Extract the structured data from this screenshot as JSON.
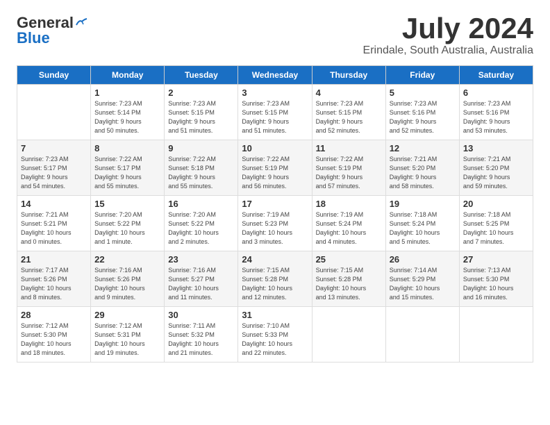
{
  "header": {
    "logo_line1": "General",
    "logo_line2": "Blue",
    "month": "July 2024",
    "location": "Erindale, South Australia, Australia"
  },
  "weekdays": [
    "Sunday",
    "Monday",
    "Tuesday",
    "Wednesday",
    "Thursday",
    "Friday",
    "Saturday"
  ],
  "weeks": [
    [
      {
        "day": "",
        "info": ""
      },
      {
        "day": "1",
        "info": "Sunrise: 7:23 AM\nSunset: 5:14 PM\nDaylight: 9 hours\nand 50 minutes."
      },
      {
        "day": "2",
        "info": "Sunrise: 7:23 AM\nSunset: 5:15 PM\nDaylight: 9 hours\nand 51 minutes."
      },
      {
        "day": "3",
        "info": "Sunrise: 7:23 AM\nSunset: 5:15 PM\nDaylight: 9 hours\nand 51 minutes."
      },
      {
        "day": "4",
        "info": "Sunrise: 7:23 AM\nSunset: 5:15 PM\nDaylight: 9 hours\nand 52 minutes."
      },
      {
        "day": "5",
        "info": "Sunrise: 7:23 AM\nSunset: 5:16 PM\nDaylight: 9 hours\nand 52 minutes."
      },
      {
        "day": "6",
        "info": "Sunrise: 7:23 AM\nSunset: 5:16 PM\nDaylight: 9 hours\nand 53 minutes."
      }
    ],
    [
      {
        "day": "7",
        "info": "Sunrise: 7:23 AM\nSunset: 5:17 PM\nDaylight: 9 hours\nand 54 minutes."
      },
      {
        "day": "8",
        "info": "Sunrise: 7:22 AM\nSunset: 5:17 PM\nDaylight: 9 hours\nand 55 minutes."
      },
      {
        "day": "9",
        "info": "Sunrise: 7:22 AM\nSunset: 5:18 PM\nDaylight: 9 hours\nand 55 minutes."
      },
      {
        "day": "10",
        "info": "Sunrise: 7:22 AM\nSunset: 5:19 PM\nDaylight: 9 hours\nand 56 minutes."
      },
      {
        "day": "11",
        "info": "Sunrise: 7:22 AM\nSunset: 5:19 PM\nDaylight: 9 hours\nand 57 minutes."
      },
      {
        "day": "12",
        "info": "Sunrise: 7:21 AM\nSunset: 5:20 PM\nDaylight: 9 hours\nand 58 minutes."
      },
      {
        "day": "13",
        "info": "Sunrise: 7:21 AM\nSunset: 5:20 PM\nDaylight: 9 hours\nand 59 minutes."
      }
    ],
    [
      {
        "day": "14",
        "info": "Sunrise: 7:21 AM\nSunset: 5:21 PM\nDaylight: 10 hours\nand 0 minutes."
      },
      {
        "day": "15",
        "info": "Sunrise: 7:20 AM\nSunset: 5:22 PM\nDaylight: 10 hours\nand 1 minute."
      },
      {
        "day": "16",
        "info": "Sunrise: 7:20 AM\nSunset: 5:22 PM\nDaylight: 10 hours\nand 2 minutes."
      },
      {
        "day": "17",
        "info": "Sunrise: 7:19 AM\nSunset: 5:23 PM\nDaylight: 10 hours\nand 3 minutes."
      },
      {
        "day": "18",
        "info": "Sunrise: 7:19 AM\nSunset: 5:24 PM\nDaylight: 10 hours\nand 4 minutes."
      },
      {
        "day": "19",
        "info": "Sunrise: 7:18 AM\nSunset: 5:24 PM\nDaylight: 10 hours\nand 5 minutes."
      },
      {
        "day": "20",
        "info": "Sunrise: 7:18 AM\nSunset: 5:25 PM\nDaylight: 10 hours\nand 7 minutes."
      }
    ],
    [
      {
        "day": "21",
        "info": "Sunrise: 7:17 AM\nSunset: 5:26 PM\nDaylight: 10 hours\nand 8 minutes."
      },
      {
        "day": "22",
        "info": "Sunrise: 7:16 AM\nSunset: 5:26 PM\nDaylight: 10 hours\nand 9 minutes."
      },
      {
        "day": "23",
        "info": "Sunrise: 7:16 AM\nSunset: 5:27 PM\nDaylight: 10 hours\nand 11 minutes."
      },
      {
        "day": "24",
        "info": "Sunrise: 7:15 AM\nSunset: 5:28 PM\nDaylight: 10 hours\nand 12 minutes."
      },
      {
        "day": "25",
        "info": "Sunrise: 7:15 AM\nSunset: 5:28 PM\nDaylight: 10 hours\nand 13 minutes."
      },
      {
        "day": "26",
        "info": "Sunrise: 7:14 AM\nSunset: 5:29 PM\nDaylight: 10 hours\nand 15 minutes."
      },
      {
        "day": "27",
        "info": "Sunrise: 7:13 AM\nSunset: 5:30 PM\nDaylight: 10 hours\nand 16 minutes."
      }
    ],
    [
      {
        "day": "28",
        "info": "Sunrise: 7:12 AM\nSunset: 5:30 PM\nDaylight: 10 hours\nand 18 minutes."
      },
      {
        "day": "29",
        "info": "Sunrise: 7:12 AM\nSunset: 5:31 PM\nDaylight: 10 hours\nand 19 minutes."
      },
      {
        "day": "30",
        "info": "Sunrise: 7:11 AM\nSunset: 5:32 PM\nDaylight: 10 hours\nand 21 minutes."
      },
      {
        "day": "31",
        "info": "Sunrise: 7:10 AM\nSunset: 5:33 PM\nDaylight: 10 hours\nand 22 minutes."
      },
      {
        "day": "",
        "info": ""
      },
      {
        "day": "",
        "info": ""
      },
      {
        "day": "",
        "info": ""
      }
    ]
  ]
}
